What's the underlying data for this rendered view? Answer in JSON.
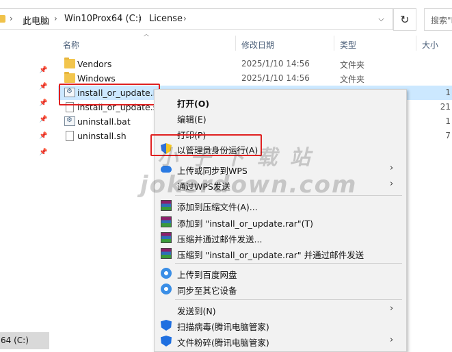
{
  "breadcrumb": {
    "items": [
      "此电脑",
      "Win10Prox64 (C:)",
      "License"
    ],
    "separator": "›"
  },
  "toolbar": {
    "dropdown_glyph": "⌵",
    "refresh_glyph": "↻",
    "search_placeholder": "搜索\"L"
  },
  "nav": {
    "drive_label": "64 (C:)"
  },
  "columns": {
    "name": "名称",
    "date": "修改日期",
    "type": "类型",
    "size": "大小"
  },
  "files": [
    {
      "name": "Vendors",
      "date": "2025/1/10 14:56",
      "type": "文件夹",
      "size": "",
      "icon": "folder-icon"
    },
    {
      "name": "Windows",
      "date": "2025/1/10 14:56",
      "type": "文件夹",
      "size": "",
      "icon": "folder-icon"
    },
    {
      "name": "install_or_update.bat",
      "date": "",
      "type": "",
      "size": "1",
      "icon": "batch-file-icon",
      "selected": true
    },
    {
      "name": "install_or_update.sh",
      "date": "",
      "type": "",
      "size": "21",
      "icon": "document-icon"
    },
    {
      "name": "uninstall.bat",
      "date": "",
      "type": "",
      "size": "1",
      "icon": "batch-file-icon"
    },
    {
      "name": "uninstall.sh",
      "date": "",
      "type": "",
      "size": "7",
      "icon": "document-icon"
    }
  ],
  "context_menu": {
    "items": [
      {
        "label": "打开(O)",
        "bold": true
      },
      {
        "label": "编辑(E)"
      },
      {
        "label": "打印(P)"
      },
      {
        "label": "以管理员身份运行(A)",
        "icon": "uac-shield-icon"
      },
      {
        "label": "上传或同步到WPS",
        "icon": "cloud-icon",
        "submenu": true
      },
      {
        "label": "通过WPS发送",
        "submenu": true
      },
      {
        "label": "添加到压缩文件(A)...",
        "icon": "winrar-icon"
      },
      {
        "label": "添加到 \"install_or_update.rar\"(T)",
        "icon": "winrar-icon"
      },
      {
        "label": "压缩并通过邮件发送...",
        "icon": "winrar-icon"
      },
      {
        "label": "压缩到 \"install_or_update.rar\" 并通过邮件发送",
        "icon": "winrar-icon"
      },
      {
        "label": "上传到百度网盘",
        "icon": "baidu-netdisk-icon"
      },
      {
        "label": "同步至其它设备",
        "icon": "baidu-netdisk-icon"
      },
      {
        "label": "发送到(N)",
        "submenu": true
      },
      {
        "label": "扫描病毒(腾讯电脑管家)",
        "icon": "tencent-guard-icon"
      },
      {
        "label": "文件粉碎(腾讯电脑管家)",
        "icon": "tencent-guard-icon",
        "submenu": true
      }
    ],
    "arrow_glyph": "›"
  },
  "watermark": {
    "line1": "小 子 下 载 站",
    "line2": "jokerdown.com"
  },
  "colors": {
    "selection": "#cce8ff",
    "highlight_box": "#e02020",
    "menu_bg": "#f2f2f2"
  }
}
